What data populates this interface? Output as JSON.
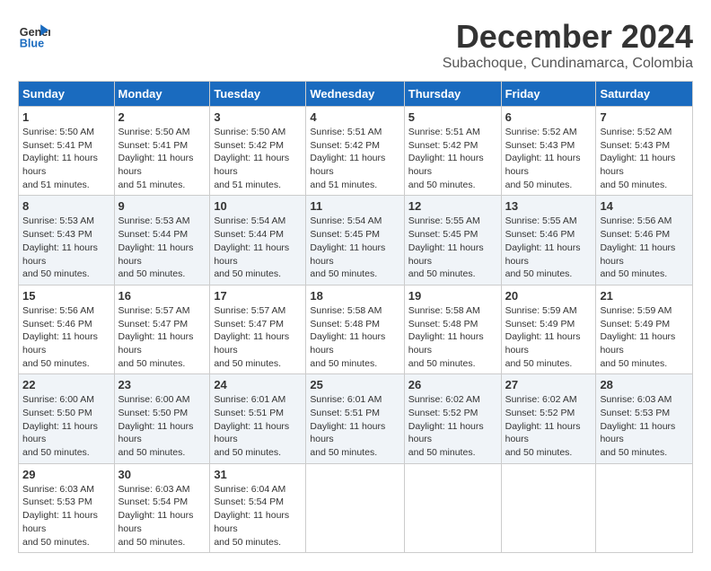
{
  "logo": {
    "line1": "General",
    "line2": "Blue"
  },
  "title": "December 2024",
  "location": "Subachoque, Cundinamarca, Colombia",
  "days_of_week": [
    "Sunday",
    "Monday",
    "Tuesday",
    "Wednesday",
    "Thursday",
    "Friday",
    "Saturday"
  ],
  "weeks": [
    [
      {
        "day": "1",
        "sunrise": "5:50 AM",
        "sunset": "5:41 PM",
        "daylight": "11 hours and 51 minutes."
      },
      {
        "day": "2",
        "sunrise": "5:50 AM",
        "sunset": "5:41 PM",
        "daylight": "11 hours and 51 minutes."
      },
      {
        "day": "3",
        "sunrise": "5:50 AM",
        "sunset": "5:42 PM",
        "daylight": "11 hours and 51 minutes."
      },
      {
        "day": "4",
        "sunrise": "5:51 AM",
        "sunset": "5:42 PM",
        "daylight": "11 hours and 51 minutes."
      },
      {
        "day": "5",
        "sunrise": "5:51 AM",
        "sunset": "5:42 PM",
        "daylight": "11 hours and 50 minutes."
      },
      {
        "day": "6",
        "sunrise": "5:52 AM",
        "sunset": "5:43 PM",
        "daylight": "11 hours and 50 minutes."
      },
      {
        "day": "7",
        "sunrise": "5:52 AM",
        "sunset": "5:43 PM",
        "daylight": "11 hours and 50 minutes."
      }
    ],
    [
      {
        "day": "8",
        "sunrise": "5:53 AM",
        "sunset": "5:43 PM",
        "daylight": "11 hours and 50 minutes."
      },
      {
        "day": "9",
        "sunrise": "5:53 AM",
        "sunset": "5:44 PM",
        "daylight": "11 hours and 50 minutes."
      },
      {
        "day": "10",
        "sunrise": "5:54 AM",
        "sunset": "5:44 PM",
        "daylight": "11 hours and 50 minutes."
      },
      {
        "day": "11",
        "sunrise": "5:54 AM",
        "sunset": "5:45 PM",
        "daylight": "11 hours and 50 minutes."
      },
      {
        "day": "12",
        "sunrise": "5:55 AM",
        "sunset": "5:45 PM",
        "daylight": "11 hours and 50 minutes."
      },
      {
        "day": "13",
        "sunrise": "5:55 AM",
        "sunset": "5:46 PM",
        "daylight": "11 hours and 50 minutes."
      },
      {
        "day": "14",
        "sunrise": "5:56 AM",
        "sunset": "5:46 PM",
        "daylight": "11 hours and 50 minutes."
      }
    ],
    [
      {
        "day": "15",
        "sunrise": "5:56 AM",
        "sunset": "5:46 PM",
        "daylight": "11 hours and 50 minutes."
      },
      {
        "day": "16",
        "sunrise": "5:57 AM",
        "sunset": "5:47 PM",
        "daylight": "11 hours and 50 minutes."
      },
      {
        "day": "17",
        "sunrise": "5:57 AM",
        "sunset": "5:47 PM",
        "daylight": "11 hours and 50 minutes."
      },
      {
        "day": "18",
        "sunrise": "5:58 AM",
        "sunset": "5:48 PM",
        "daylight": "11 hours and 50 minutes."
      },
      {
        "day": "19",
        "sunrise": "5:58 AM",
        "sunset": "5:48 PM",
        "daylight": "11 hours and 50 minutes."
      },
      {
        "day": "20",
        "sunrise": "5:59 AM",
        "sunset": "5:49 PM",
        "daylight": "11 hours and 50 minutes."
      },
      {
        "day": "21",
        "sunrise": "5:59 AM",
        "sunset": "5:49 PM",
        "daylight": "11 hours and 50 minutes."
      }
    ],
    [
      {
        "day": "22",
        "sunrise": "6:00 AM",
        "sunset": "5:50 PM",
        "daylight": "11 hours and 50 minutes."
      },
      {
        "day": "23",
        "sunrise": "6:00 AM",
        "sunset": "5:50 PM",
        "daylight": "11 hours and 50 minutes."
      },
      {
        "day": "24",
        "sunrise": "6:01 AM",
        "sunset": "5:51 PM",
        "daylight": "11 hours and 50 minutes."
      },
      {
        "day": "25",
        "sunrise": "6:01 AM",
        "sunset": "5:51 PM",
        "daylight": "11 hours and 50 minutes."
      },
      {
        "day": "26",
        "sunrise": "6:02 AM",
        "sunset": "5:52 PM",
        "daylight": "11 hours and 50 minutes."
      },
      {
        "day": "27",
        "sunrise": "6:02 AM",
        "sunset": "5:52 PM",
        "daylight": "11 hours and 50 minutes."
      },
      {
        "day": "28",
        "sunrise": "6:03 AM",
        "sunset": "5:53 PM",
        "daylight": "11 hours and 50 minutes."
      }
    ],
    [
      {
        "day": "29",
        "sunrise": "6:03 AM",
        "sunset": "5:53 PM",
        "daylight": "11 hours and 50 minutes."
      },
      {
        "day": "30",
        "sunrise": "6:03 AM",
        "sunset": "5:54 PM",
        "daylight": "11 hours and 50 minutes."
      },
      {
        "day": "31",
        "sunrise": "6:04 AM",
        "sunset": "5:54 PM",
        "daylight": "11 hours and 50 minutes."
      },
      null,
      null,
      null,
      null
    ]
  ]
}
